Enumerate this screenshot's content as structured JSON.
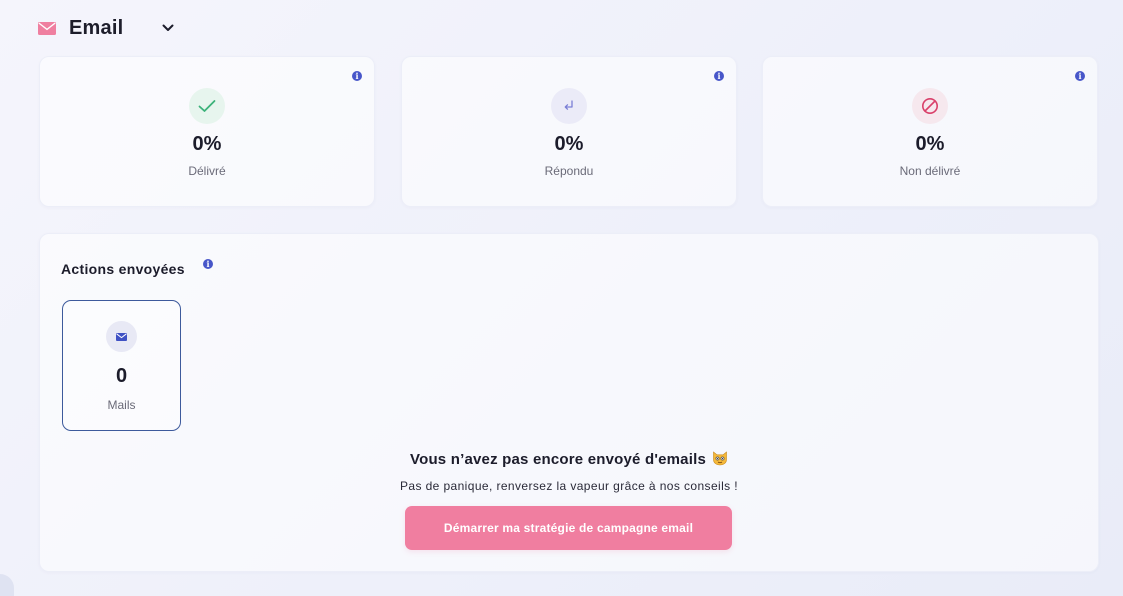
{
  "header": {
    "icon": "envelope-icon",
    "title": "Email",
    "dropdown_icon": "chevron-down-icon"
  },
  "stats": [
    {
      "icon": "check-icon",
      "value": "0%",
      "label": "Délivré",
      "color": "#3bb27a"
    },
    {
      "icon": "reply-arrow-icon",
      "value": "0%",
      "label": "Répondu",
      "color": "#7b7fd6"
    },
    {
      "icon": "prohibited-icon",
      "value": "0%",
      "label": "Non délivré",
      "color": "#d9406a"
    }
  ],
  "actions": {
    "title": "Actions envoyées",
    "mail_tile": {
      "icon": "envelope-icon",
      "value": "0",
      "label": "Mails"
    },
    "empty_state": {
      "title": "Vous n’avez pas encore envoyé d'emails",
      "emoji": "cat-face-icon",
      "subtitle": "Pas de panique, renversez la vapeur grâce à nos conseils !",
      "cta_label": "Démarrer ma stratégie de campagne email"
    }
  },
  "colors": {
    "accent_pink": "#f07ea0",
    "info_blue": "#4756c9",
    "tile_border": "#3d5a9c"
  }
}
